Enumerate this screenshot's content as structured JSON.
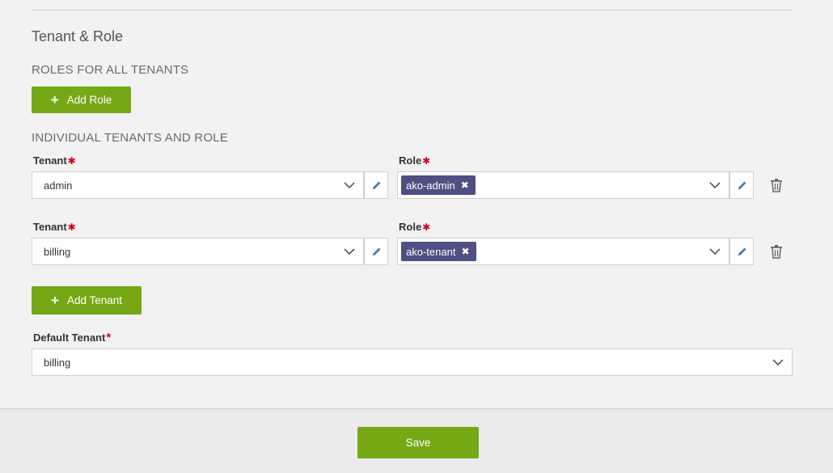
{
  "section": {
    "title": "Tenant & Role"
  },
  "roles_all": {
    "heading": "ROLES FOR ALL TENANTS",
    "add_button": "Add Role"
  },
  "individual": {
    "heading": "INDIVIDUAL TENANTS AND ROLE",
    "rows": [
      {
        "tenant_label": "Tenant",
        "tenant_value": "admin",
        "role_label": "Role",
        "role_tag": "ako-admin"
      },
      {
        "tenant_label": "Tenant",
        "tenant_value": "billing",
        "role_label": "Role",
        "role_tag": "ako-tenant"
      }
    ],
    "required_mark": "✱",
    "add_button": "Add Tenant"
  },
  "default_tenant": {
    "label": "Default Tenant",
    "required_mark": "*",
    "value": "billing"
  },
  "footer": {
    "save_label": "Save"
  },
  "icons": {
    "chevron": "chevron-down-icon",
    "pencil": "pencil-icon",
    "trash": "trash-icon",
    "plus": "plus-icon",
    "remove": "remove-tag-icon"
  },
  "colors": {
    "accent_green": "#76a815",
    "tag_bg": "#4e4f82",
    "required_red": "#d0021b",
    "edit_icon": "#3f82b4"
  }
}
